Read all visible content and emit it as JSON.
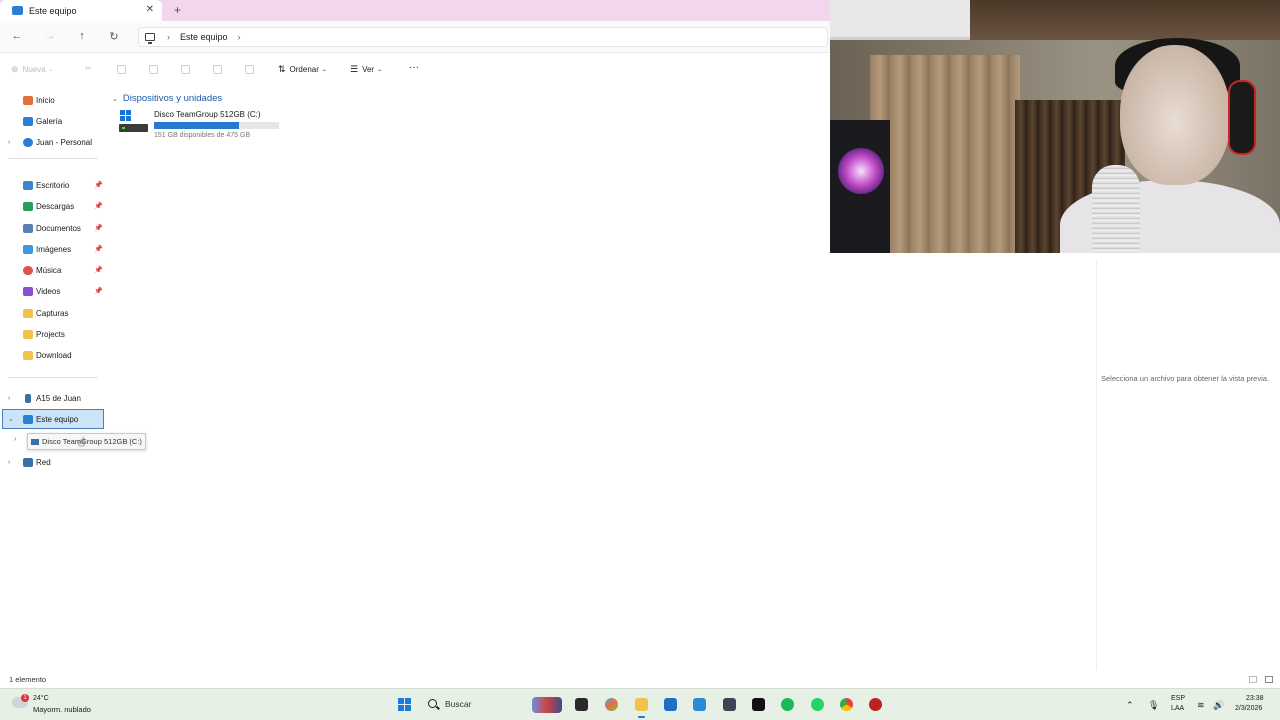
{
  "window": {
    "tab_title": "Este equipo",
    "tab_close": "✕",
    "new_tab": "+"
  },
  "nav": {
    "back": "←",
    "forward": "→",
    "up": "↑",
    "refresh": "↻"
  },
  "address": {
    "crumbs": [
      "Este equipo"
    ],
    "sep": "›"
  },
  "toolbar": {
    "new_label": "Nueva",
    "sort_label": "Ordenar",
    "view_label": "Ver",
    "more": "···"
  },
  "sidebar": {
    "items": [
      {
        "label": "Inicio",
        "icon": "home-icon",
        "color": "#e0703a"
      },
      {
        "label": "Galería",
        "icon": "gallery-icon",
        "color": "#2a7fd4"
      },
      {
        "label": "Juan - Personal",
        "icon": "cloud-icon",
        "color": "#2a7fd4"
      },
      {
        "label": "Escritorio",
        "icon": "desktop-icon",
        "color": "#3a86c9"
      },
      {
        "label": "Descargas",
        "icon": "download-icon",
        "color": "#2a9d5c"
      },
      {
        "label": "Documentos",
        "icon": "documents-icon",
        "color": "#5a7fb0"
      },
      {
        "label": "Imágenes",
        "icon": "pictures-icon",
        "color": "#3a9ad8"
      },
      {
        "label": "Música",
        "icon": "music-icon",
        "color": "#e0544a"
      },
      {
        "label": "Videos",
        "icon": "videos-icon",
        "color": "#8a4fd0"
      },
      {
        "label": "Capturas",
        "icon": "folder-icon",
        "color": "#f2c14e"
      },
      {
        "label": "Projects",
        "icon": "folder-icon",
        "color": "#f2c14e"
      },
      {
        "label": "Download",
        "icon": "folder-icon",
        "color": "#f2c14e"
      },
      {
        "label": "A15 de Juan",
        "icon": "phone-icon",
        "color": "#3a6fa8"
      },
      {
        "label": "Este equipo",
        "icon": "pc-icon",
        "color": "#2a7fd4"
      },
      {
        "label": "Red",
        "icon": "network-icon",
        "color": "#3a6fa8"
      }
    ],
    "drag_tooltip": "Disco TeamGroup 512GB (C:)"
  },
  "main": {
    "group_title": "Dispositivos y unidades",
    "drive": {
      "name": "Disco TeamGroup 512GB (C:)",
      "free_text": "151 GB disponibles de 475 GB",
      "used_fraction": 0.68
    }
  },
  "preview": {
    "message": "Selecciona un archivo para obtener la vista previa."
  },
  "status": {
    "count": "1 elemento"
  },
  "taskbar": {
    "weather_temp": "24°C",
    "weather_desc": "Mayorm. nublado",
    "weather_badge": "1",
    "search_placeholder": "Buscar",
    "lang_top": "ESP",
    "lang_bottom": "LAA",
    "time": "23:38",
    "date": "2/3/2026"
  },
  "colors": {
    "accent": "#2679d1",
    "tab_bar": "#f2d6ee",
    "taskbar": "#e6f0e4",
    "selection": "#cce4f7"
  }
}
